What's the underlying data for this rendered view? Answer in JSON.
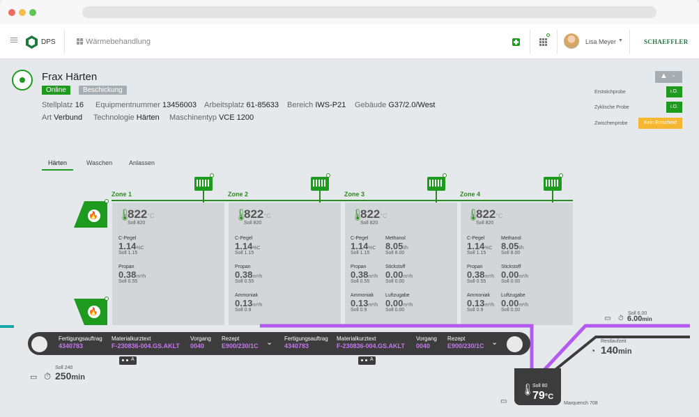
{
  "chrome": {
    "dots": [
      "#ee6a5f",
      "#f5bd4f",
      "#61c454"
    ]
  },
  "appbar": {
    "logo_text": "DPS",
    "breadcrumb": "Wärmebehandlung",
    "user_name": "Lisa Meyer",
    "brand": "SCHAEFFLER"
  },
  "header": {
    "title": "Frax Härten",
    "status_online": "Online",
    "status_loading": "Beschickung",
    "warning_label": "-",
    "props_row1": [
      {
        "label": "Stellplatz",
        "value": "16"
      },
      {
        "label": "Equipmentnummer",
        "value": "13456003"
      },
      {
        "label": "Arbeitsplatz",
        "value": "61-85633"
      },
      {
        "label": "Bereich",
        "value": "IWS-P21"
      },
      {
        "label": "Gebäude",
        "value": "G37/2.0/West"
      }
    ],
    "props_row2": [
      {
        "label": "Art",
        "value": "Verbund"
      },
      {
        "label": "Technologie",
        "value": "Härten"
      },
      {
        "label": "Maschinentyp",
        "value": "VCE 1200"
      }
    ]
  },
  "checks": [
    {
      "label": "Erststichprobe",
      "value": "i.O.",
      "color": "#1e9a1e"
    },
    {
      "label": "Zyklische Probe",
      "value": "i.O.",
      "color": "#1e9a1e"
    },
    {
      "label": "Zwischenprobe",
      "value": "Kein Entscheid",
      "color": "#f5b731"
    }
  ],
  "tabs": [
    "Härten",
    "Waschen",
    "Anlassen"
  ],
  "zones": [
    {
      "title": "Zone 1",
      "temp": "822",
      "temp_unit": "°C",
      "soll": "Soll 820",
      "cpegel_label": "C-Pegel",
      "cpegel": "1.14",
      "cpegel_unit": "%C",
      "cpegel_soll": "Soll 1.15",
      "propan_label": "Propan",
      "propan": "0.38",
      "propan_unit": "m³/h",
      "propan_soll": "Soll 0.55"
    },
    {
      "title": "Zone 2",
      "temp": "822",
      "temp_unit": "°C",
      "soll": "Soll 820",
      "cpegel_label": "C-Pegel",
      "cpegel": "1.14",
      "cpegel_unit": "%C",
      "cpegel_soll": "Soll 1.15",
      "propan_label": "Propan",
      "propan": "0.38",
      "propan_unit": "m³/h",
      "propan_soll": "Soll 0.55",
      "ammoniak_label": "Ammoniak",
      "ammoniak": "0.13",
      "ammoniak_unit": "m³/h",
      "ammoniak_soll": "Soll 0.9"
    },
    {
      "title": "Zone 3",
      "temp": "822",
      "temp_unit": "°C",
      "soll": "Soll 820",
      "cpegel_label": "C-Pegel",
      "cpegel": "1.14",
      "cpegel_unit": "%C",
      "cpegel_soll": "Soll 1.15",
      "methanol_label": "Methanol",
      "methanol": "8.05",
      "methanol_unit": "l/h",
      "methanol_soll": "Soll 8.00",
      "propan_label": "Propan",
      "propan": "0.38",
      "propan_unit": "m³/h",
      "propan_soll": "Soll 0.55",
      "stickstoff_label": "Stickstoff",
      "stickstoff": "0.00",
      "stickstoff_unit": "m³/h",
      "stickstoff_soll": "Soll 0.00",
      "ammoniak_label": "Ammoniak",
      "ammoniak": "0.13",
      "ammoniak_unit": "m³/h",
      "ammoniak_soll": "Soll 0.9",
      "luft_label": "Luftzugabe",
      "luft": "0.00",
      "luft_unit": "m³/h",
      "luft_soll": "Soll 0.00"
    },
    {
      "title": "Zone 4",
      "temp": "822",
      "temp_unit": "°C",
      "soll": "Soll 820",
      "cpegel_label": "C-Pegel",
      "cpegel": "1.14",
      "cpegel_unit": "%C",
      "cpegel_soll": "Soll 1.15",
      "methanol_label": "Methanol",
      "methanol": "8.05",
      "methanol_unit": "l/h",
      "methanol_soll": "Soll 8.00",
      "propan_label": "Propan",
      "propan": "0.38",
      "propan_unit": "m³/h",
      "propan_soll": "Soll 0.55",
      "stickstoff_label": "Stickstoff",
      "stickstoff": "0.00",
      "stickstoff_unit": "m³/h",
      "stickstoff_soll": "Soll 0.00",
      "ammoniak_label": "Ammoniak",
      "ammoniak": "0.13",
      "ammoniak_unit": "m³/h",
      "ammoniak_soll": "Soll 0.9",
      "luft_label": "Luftzugabe",
      "luft": "0.00",
      "luft_unit": "m³/h",
      "luft_soll": "Soll 0.00"
    }
  ],
  "conveyor": {
    "orders": [
      {
        "auftrag_label": "Fertigungsauftrag",
        "auftrag": "4340783",
        "material_label": "Materialkurztext",
        "material": "F-230836-004.GS.AKLT",
        "vorgang_label": "Vorgang",
        "vorgang": "0040",
        "rezept_label": "Rezept",
        "rezept": "E900/230/1C"
      },
      {
        "auftrag_label": "Fertigungsauftrag",
        "auftrag": "4340783",
        "material_label": "Materialkurztext",
        "material": "F-230836-004.GS.AKLT",
        "vorgang_label": "Vorgang",
        "vorgang": "0040",
        "rezept_label": "Rezept",
        "rezept": "E900/230/1C"
      }
    ],
    "left_soll": "Soll 240",
    "left_time": "250",
    "left_unit": "min",
    "right_soll": "Soll 6.00",
    "right_time": "6.00",
    "right_unit": "min",
    "rest_label": "Restlaufzeit",
    "rest_time": "140",
    "rest_unit": "min"
  },
  "quench": {
    "soll": "Soll 80",
    "temp": "79",
    "unit": "°C",
    "name": "Marquench 708"
  },
  "colors": {
    "green": "#2b8a1e",
    "purple": "#b45af2",
    "dark": "#3c3c3c",
    "amber": "#f5b731"
  }
}
